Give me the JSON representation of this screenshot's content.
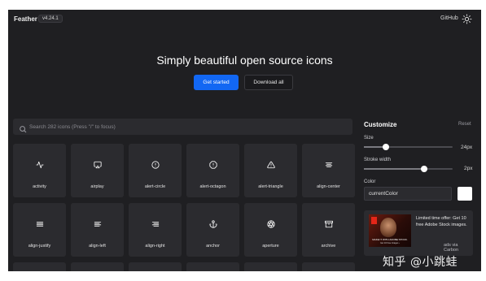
{
  "header": {
    "brand": "Feather",
    "version": "v4.24.1",
    "github_link": "GitHub",
    "theme_icon": "sun-icon"
  },
  "hero": {
    "title": "Simply beautiful open source icons",
    "primary_button": "Get started",
    "secondary_button": "Download all"
  },
  "search": {
    "placeholder": "Search 282 icons (Press \"/\" to focus)",
    "value": "",
    "icon": "search-icon"
  },
  "icons": [
    {
      "label": "activity",
      "icon": "activity-icon"
    },
    {
      "label": "airplay",
      "icon": "airplay-icon"
    },
    {
      "label": "alert-circle",
      "icon": "alert-circle-icon"
    },
    {
      "label": "alert-octagon",
      "icon": "alert-octagon-icon"
    },
    {
      "label": "alert-triangle",
      "icon": "alert-triangle-icon"
    },
    {
      "label": "align-center",
      "icon": "align-center-icon"
    },
    {
      "label": "align-justify",
      "icon": "align-justify-icon"
    },
    {
      "label": "align-left",
      "icon": "align-left-icon"
    },
    {
      "label": "align-right",
      "icon": "align-right-icon"
    },
    {
      "label": "anchor",
      "icon": "anchor-icon"
    },
    {
      "label": "aperture",
      "icon": "aperture-icon"
    },
    {
      "label": "archive",
      "icon": "archive-icon"
    }
  ],
  "customize": {
    "title": "Customize",
    "reset": "Reset",
    "size_label": "Size",
    "size_value": "24px",
    "size_fraction": 0.25,
    "stroke_label": "Stroke width",
    "stroke_value": "2px",
    "stroke_fraction": 0.68,
    "color_label": "Color",
    "color_value": "currentColor",
    "swatch_color": "#ffffff"
  },
  "ad": {
    "image_caption": "MAKE IT WITH ADOBE STOCK.",
    "image_subcaption": "Get 10 Free Images ›",
    "text": "Limited time offer: Get 10 free Adobe Stock images.",
    "via": "ads via Carbon"
  },
  "watermark": "知乎 @小跳蛙",
  "colors": {
    "background": "#1f1f22",
    "tile": "#2b2b2f",
    "accent": "#1267f3"
  }
}
